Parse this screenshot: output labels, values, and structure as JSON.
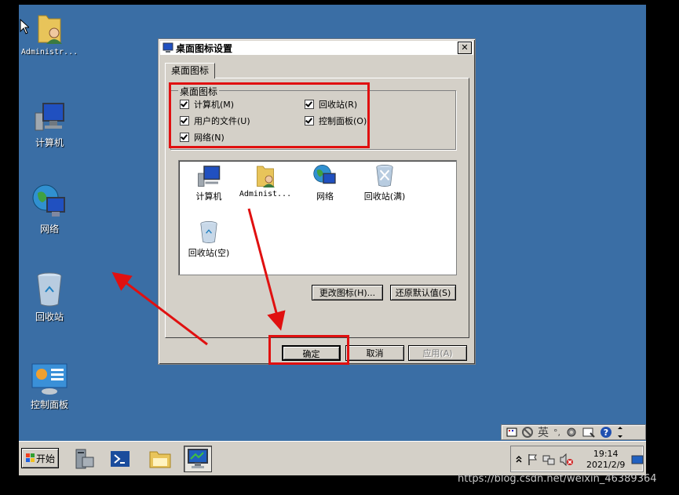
{
  "desktop": {
    "icons": [
      {
        "label": "Administr..."
      },
      {
        "label": "计算机"
      },
      {
        "label": "网络"
      },
      {
        "label": "回收站"
      },
      {
        "label": "控制面板"
      }
    ]
  },
  "dialog": {
    "title": "桌面图标设置",
    "close_glyph": "✕",
    "tab": "桌面图标",
    "group_title": "桌面图标",
    "checkboxes": [
      {
        "label": "计算机(M)",
        "checked": true
      },
      {
        "label": "用户的文件(U)",
        "checked": true
      },
      {
        "label": "网络(N)",
        "checked": true
      },
      {
        "label": "回收站(R)",
        "checked": true
      },
      {
        "label": "控制面板(O)",
        "checked": true
      }
    ],
    "list_items": [
      {
        "label": "计算机"
      },
      {
        "label": "Administ..."
      },
      {
        "label": "网络"
      },
      {
        "label": "回收站(满)"
      },
      {
        "label": "回收站(空)"
      }
    ],
    "change_icon_button": "更改图标(H)...",
    "restore_default_button": "还原默认值(S)",
    "ok_button": "确定",
    "cancel_button": "取消",
    "apply_button": "应用(A)"
  },
  "taskbar": {
    "start_label": "开始",
    "lang_label": "英",
    "lang_punct": "°,",
    "clock_time": "19:14",
    "clock_date": "2021/2/9"
  },
  "watermark": "https://blog.csdn.net/weixin_46389364",
  "colors": {
    "desktop_bg": "#3a6ea5",
    "highlight_red": "#e01010",
    "dialog_face": "#d4d0c8"
  }
}
